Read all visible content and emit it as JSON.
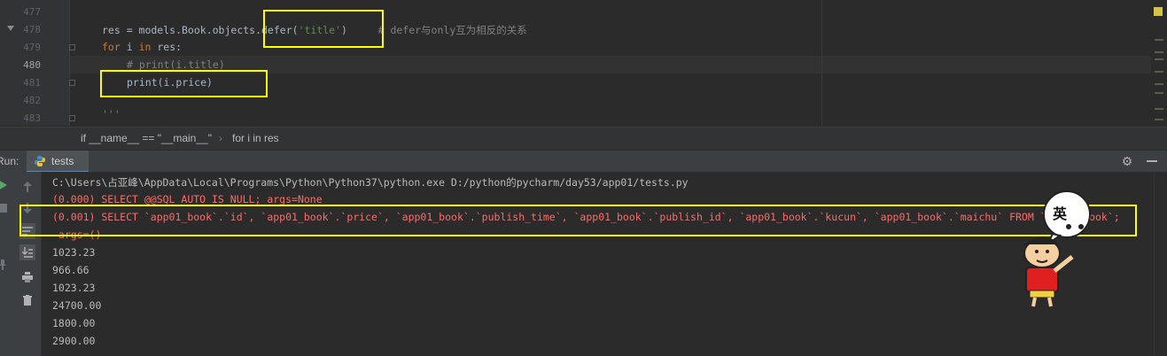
{
  "editor": {
    "line_numbers": [
      "477",
      "478",
      "479",
      "480",
      "481",
      "482",
      "483"
    ],
    "lines": {
      "l478_code": "res = models.Book.objects.defer(",
      "l478_str": "'title'",
      "l478_close": ")",
      "l478_comment": "# defer与only互为相反的关系",
      "l479_for": "for",
      "l479_mid": " i ",
      "l479_in": "in",
      "l479_rest": " res:",
      "l480_comment": "# print(i.title)",
      "l481_code": "print(i.price)",
      "l483_code": "'''"
    }
  },
  "breadcrumb": {
    "item1": "if __name__ == \"__main__\"",
    "separator": "›",
    "item2": "for i in res"
  },
  "run_panel": {
    "label": "Run:",
    "tab_label": "tests"
  },
  "console": {
    "command": "C:\\Users\\占亚峰\\AppData\\Local\\Programs\\Python\\Python37\\python.exe D:/python的pycharm/day53/app01/tests.py",
    "sql1": "(0.000) SELECT @@SQL_AUTO_IS_NULL; args=None",
    "sql2": "(0.001) SELECT `app01_book`.`id`, `app01_book`.`price`, `app01_book`.`publish_time`, `app01_book`.`publish_id`, `app01_book`.`kucun`, `app01_book`.`maichu` FROM `app01_book`;",
    "sql2_args": " args=()",
    "outputs": [
      "1023.23",
      "966.66",
      "1023.23",
      "24700.00",
      "1800.00",
      "2900.00"
    ]
  },
  "sticker": {
    "text": "英"
  },
  "colors": {
    "highlight_box": "#ffff00",
    "sql_text": "#ff6b68",
    "console_text": "#bbbbbb",
    "keyword": "#cc7832",
    "string": "#6a8759",
    "comment": "#808080"
  },
  "icons": [
    "python-file-icon",
    "settings-gear-icon",
    "minimize-icon",
    "rerun-play-icon",
    "stop-icon",
    "scroll-up-icon",
    "scroll-down-icon",
    "soft-wrap-icon",
    "scroll-to-end-icon",
    "print-icon",
    "pin-icon",
    "trash-icon"
  ]
}
